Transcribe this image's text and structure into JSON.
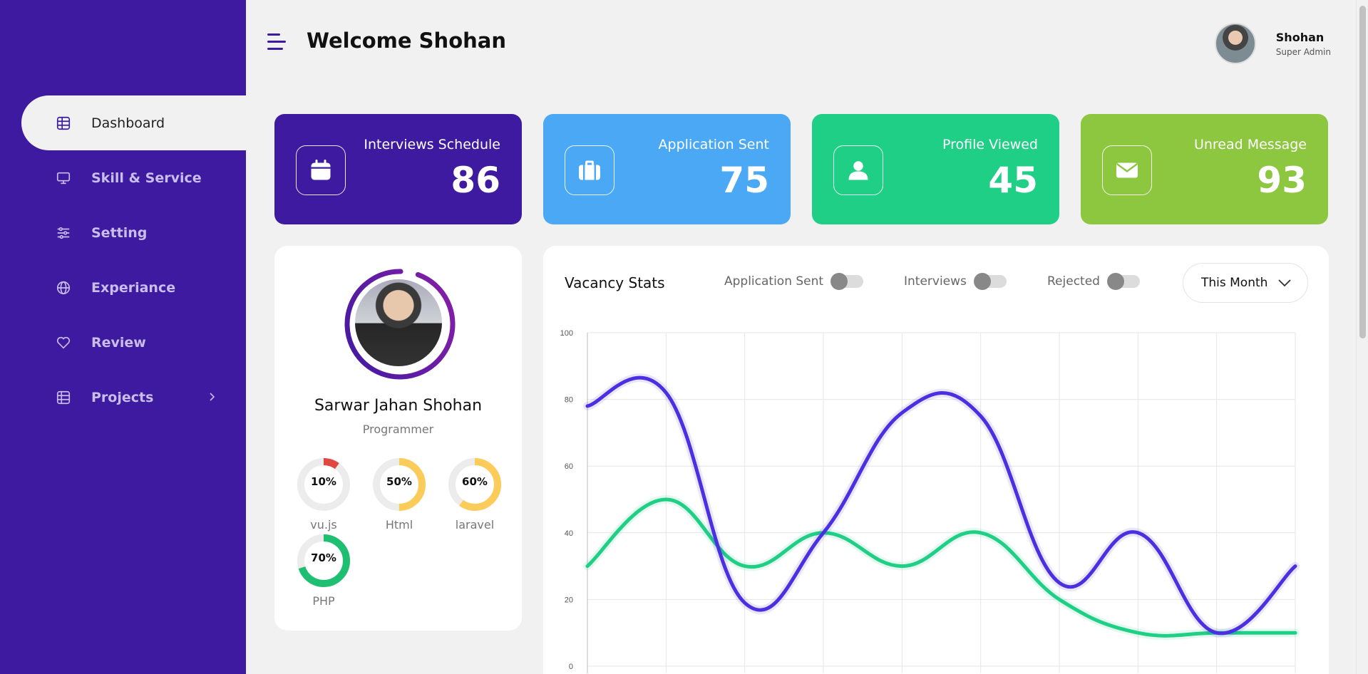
{
  "sidebar": {
    "items": [
      {
        "label": "Dashboard",
        "icon": "dashboard-icon",
        "active": true
      },
      {
        "label": "Skill & Service",
        "icon": "monitor-icon"
      },
      {
        "label": "Setting",
        "icon": "sliders-icon"
      },
      {
        "label": "Experiance",
        "icon": "globe-icon"
      },
      {
        "label": "Review",
        "icon": "heart-icon"
      },
      {
        "label": "Projects",
        "icon": "projects-icon",
        "has_submenu": true
      }
    ]
  },
  "header": {
    "title": "Welcome Shohan",
    "user_name": "Shohan",
    "user_role": "Super Admin"
  },
  "stats": [
    {
      "label": "Interviews Schedule",
      "value": "86",
      "icon": "calendar-icon",
      "color": "#3e1aa0"
    },
    {
      "label": "Application Sent",
      "value": "75",
      "icon": "briefcase-icon",
      "color": "#4aa8f5"
    },
    {
      "label": "Profile Viewed",
      "value": "45",
      "icon": "user-icon",
      "color": "#1fcf85"
    },
    {
      "label": "Unread Message",
      "value": "93",
      "icon": "envelope-icon",
      "color": "#8dc63f"
    }
  ],
  "profile": {
    "name": "Sarwar Jahan Shohan",
    "role": "Programmer",
    "skills": [
      {
        "name": "vu.js",
        "percent": 10,
        "label": "10%",
        "color": "#e0473f"
      },
      {
        "name": "Html",
        "percent": 50,
        "label": "50%",
        "color": "#fccc5a"
      },
      {
        "name": "laravel",
        "percent": 60,
        "label": "60%",
        "color": "#fccc5a"
      },
      {
        "name": "PHP",
        "percent": 70,
        "label": "70%",
        "color": "#1fbf72"
      }
    ]
  },
  "vacancy": {
    "title": "Vacancy Stats",
    "toggles": [
      "Application Sent",
      "Interviews",
      "Rejected"
    ],
    "period": "This Month"
  },
  "chart_data": {
    "type": "line",
    "x": [
      0,
      1,
      2,
      3,
      4,
      5,
      6,
      7,
      8,
      9
    ],
    "ylim": [
      0,
      100
    ],
    "yticks": [
      "100",
      "80",
      "60",
      "40",
      "20",
      "0"
    ],
    "grid": true,
    "series": [
      {
        "color": "#4b30e2",
        "values": [
          78,
          82,
          19,
          40,
          76,
          75,
          25,
          40,
          10,
          30
        ]
      },
      {
        "color": "#1fcf85",
        "values": [
          30,
          50,
          30,
          40,
          30,
          40,
          20,
          10,
          10,
          10
        ]
      }
    ]
  }
}
